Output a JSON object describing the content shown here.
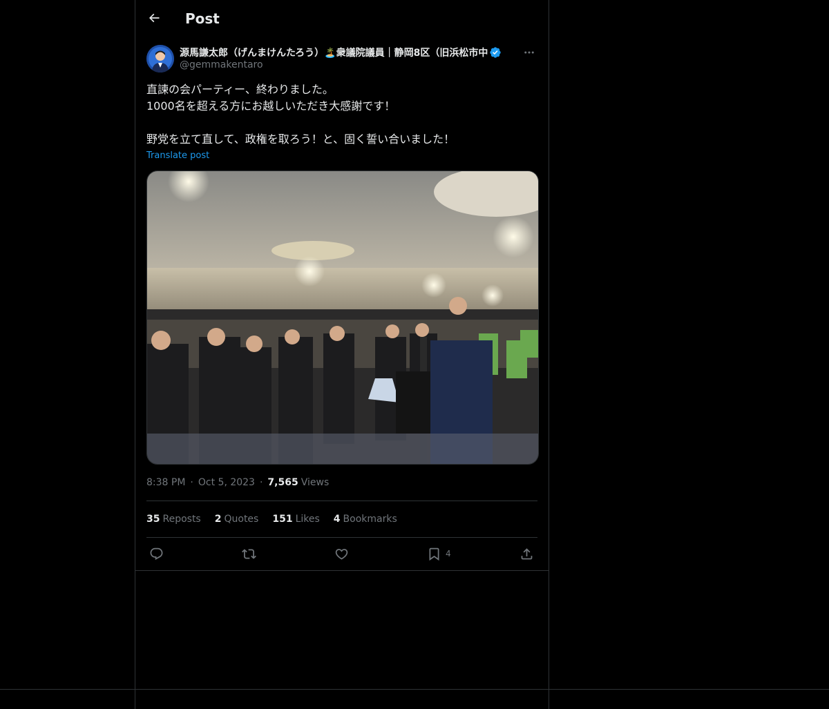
{
  "header": {
    "title": "Post"
  },
  "author": {
    "display_name": "源馬謙太郎（げんまけんたろう）🏝️衆議院議員｜静岡8区（旧浜松市中",
    "handle": "@gemmakentaro"
  },
  "post": {
    "lines": [
      "直諫の会パーティー、終わりました。",
      "1000名を超える方にお越しいただき大感謝です！",
      "",
      "野党を立て直して、政権を取ろう！と、固く誓い合いました！"
    ],
    "translate_label": "Translate post"
  },
  "meta": {
    "time": "8:38 PM",
    "date": "Oct 5, 2023",
    "views_count": "7,565",
    "views_label": "Views"
  },
  "stats": {
    "reposts_count": "35",
    "reposts_label": "Reposts",
    "quotes_count": "2",
    "quotes_label": "Quotes",
    "likes_count": "151",
    "likes_label": "Likes",
    "bookmarks_count": "4",
    "bookmarks_label": "Bookmarks"
  },
  "actions": {
    "bookmark_count": "4"
  },
  "colors": {
    "background": "#000000",
    "text": "#e7e9ea",
    "secondary": "#71767b",
    "accent": "#1d9bf0",
    "border": "#2f3336"
  },
  "icons": {
    "back": "arrow-left-icon",
    "verified": "verified-badge-icon",
    "more": "more-horizontal-icon",
    "reply": "reply-icon",
    "repost": "repost-icon",
    "like": "heart-icon",
    "bookmark": "bookmark-icon",
    "share": "share-icon"
  }
}
